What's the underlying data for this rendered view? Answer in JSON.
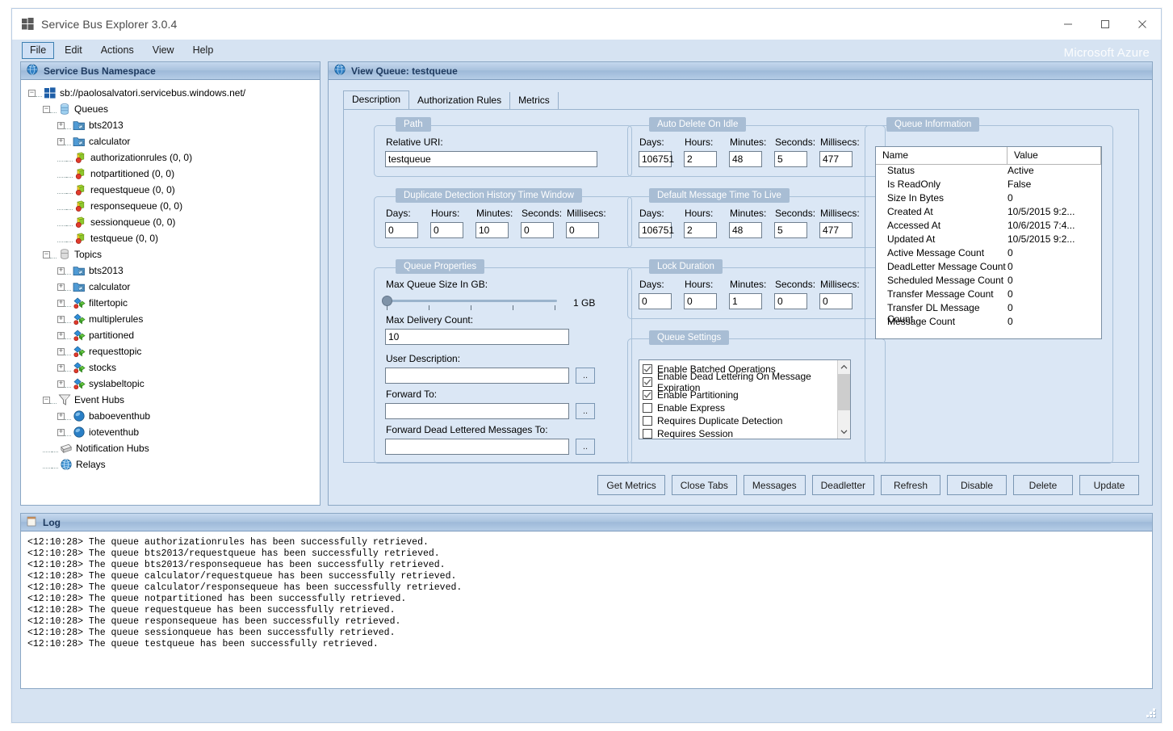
{
  "window": {
    "title": "Service Bus Explorer 3.0.4",
    "brand": "Microsoft Azure",
    "minimize": "minimize-icon",
    "maximize": "maximize-icon",
    "close": "close-icon"
  },
  "menu": {
    "items": [
      {
        "label": "File",
        "active": true
      },
      {
        "label": "Edit",
        "active": false
      },
      {
        "label": "Actions",
        "active": false
      },
      {
        "label": "View",
        "active": false
      },
      {
        "label": "Help",
        "active": false
      }
    ]
  },
  "left_panel": {
    "header": "Service Bus Namespace",
    "tree": [
      {
        "label": "sb://paolosalvatori.servicebus.windows.net/",
        "indent": 0,
        "expander": "minus",
        "icon": "namespace-icon"
      },
      {
        "label": "Queues",
        "indent": 1,
        "expander": "minus",
        "icon": "queues-icon"
      },
      {
        "label": "bts2013",
        "indent": 2,
        "expander": "plus",
        "icon": "folder-icon"
      },
      {
        "label": "calculator",
        "indent": 2,
        "expander": "plus",
        "icon": "folder-icon"
      },
      {
        "label": "authorizationrules (0, 0)",
        "indent": 2,
        "expander": "none",
        "icon": "queue-icon"
      },
      {
        "label": "notpartitioned (0, 0)",
        "indent": 2,
        "expander": "none",
        "icon": "queue-icon"
      },
      {
        "label": "requestqueue (0, 0)",
        "indent": 2,
        "expander": "none",
        "icon": "queue-icon"
      },
      {
        "label": "responsequeue (0, 0)",
        "indent": 2,
        "expander": "none",
        "icon": "queue-icon"
      },
      {
        "label": "sessionqueue (0, 0)",
        "indent": 2,
        "expander": "none",
        "icon": "queue-icon"
      },
      {
        "label": "testqueue (0, 0)",
        "indent": 2,
        "expander": "none",
        "icon": "queue-icon"
      },
      {
        "label": "Topics",
        "indent": 1,
        "expander": "minus",
        "icon": "topics-icon"
      },
      {
        "label": "bts2013",
        "indent": 2,
        "expander": "plus",
        "icon": "folder-icon"
      },
      {
        "label": "calculator",
        "indent": 2,
        "expander": "plus",
        "icon": "folder-icon"
      },
      {
        "label": "filtertopic",
        "indent": 2,
        "expander": "plus",
        "icon": "topic-icon"
      },
      {
        "label": "multiplerules",
        "indent": 2,
        "expander": "plus",
        "icon": "topic-icon"
      },
      {
        "label": "partitioned",
        "indent": 2,
        "expander": "plus",
        "icon": "topic-icon"
      },
      {
        "label": "requesttopic",
        "indent": 2,
        "expander": "plus",
        "icon": "topic-icon"
      },
      {
        "label": "stocks",
        "indent": 2,
        "expander": "plus",
        "icon": "topic-icon"
      },
      {
        "label": "syslabeltopic",
        "indent": 2,
        "expander": "plus",
        "icon": "topic-icon"
      },
      {
        "label": "Event Hubs",
        "indent": 1,
        "expander": "minus",
        "icon": "eventhubs-icon"
      },
      {
        "label": "baboeventhub",
        "indent": 2,
        "expander": "plus",
        "icon": "eventhub-icon"
      },
      {
        "label": "ioteventhub",
        "indent": 2,
        "expander": "plus",
        "icon": "eventhub-icon"
      },
      {
        "label": "Notification Hubs",
        "indent": 1,
        "expander": "none",
        "icon": "notificationhubs-icon"
      },
      {
        "label": "Relays",
        "indent": 1,
        "expander": "none",
        "icon": "relays-icon"
      }
    ]
  },
  "right_panel": {
    "header": "View Queue: testqueue",
    "tabs": [
      {
        "label": "Description",
        "selected": true
      },
      {
        "label": "Authorization Rules",
        "selected": false
      },
      {
        "label": "Metrics",
        "selected": false
      }
    ],
    "path": {
      "title": "Path",
      "relative_uri_label": "Relative URI:",
      "relative_uri_value": "testqueue"
    },
    "duplicate_detection": {
      "title": "Duplicate Detection History Time Window",
      "labels": [
        "Days:",
        "Hours:",
        "Minutes:",
        "Seconds:",
        "Millisecs:"
      ],
      "values": [
        "0",
        "0",
        "10",
        "0",
        "0"
      ]
    },
    "queue_properties": {
      "title": "Queue Properties",
      "max_queue_size_label": "Max Queue Size In GB:",
      "max_queue_size_value": "1 GB",
      "max_delivery_count_label": "Max Delivery Count:",
      "max_delivery_count_value": "10",
      "user_description_label": "User Description:",
      "user_description_value": "",
      "forward_to_label": "Forward To:",
      "forward_to_value": "",
      "forward_dl_label": "Forward Dead Lettered Messages To:",
      "forward_dl_value": "",
      "browse_label": ".."
    },
    "auto_delete": {
      "title": "Auto Delete On Idle",
      "labels": [
        "Days:",
        "Hours:",
        "Minutes:",
        "Seconds:",
        "Millisecs:"
      ],
      "values": [
        "106751",
        "2",
        "48",
        "5",
        "477"
      ]
    },
    "default_ttl": {
      "title": "Default Message Time To Live",
      "labels": [
        "Days:",
        "Hours:",
        "Minutes:",
        "Seconds:",
        "Millisecs:"
      ],
      "values": [
        "106751",
        "2",
        "48",
        "5",
        "477"
      ]
    },
    "lock_duration": {
      "title": "Lock Duration",
      "labels": [
        "Days:",
        "Hours:",
        "Minutes:",
        "Seconds:",
        "Millisecs:"
      ],
      "values": [
        "0",
        "0",
        "1",
        "0",
        "0"
      ]
    },
    "queue_settings": {
      "title": "Queue Settings",
      "options": [
        {
          "label": "Enable Batched Operations",
          "checked": true
        },
        {
          "label": "Enable Dead Lettering On Message Expiration",
          "checked": true
        },
        {
          "label": "Enable Partitioning",
          "checked": true
        },
        {
          "label": "Enable Express",
          "checked": false
        },
        {
          "label": "Requires Duplicate Detection",
          "checked": false
        },
        {
          "label": "Requires Session",
          "checked": false
        }
      ]
    },
    "queue_information": {
      "title": "Queue Information",
      "columns": [
        "Name",
        "Value"
      ],
      "rows": [
        [
          "Status",
          "Active"
        ],
        [
          "Is ReadOnly",
          "False"
        ],
        [
          "Size In Bytes",
          "0"
        ],
        [
          "Created At",
          "10/5/2015 9:2..."
        ],
        [
          "Accessed At",
          "10/6/2015 7:4..."
        ],
        [
          "Updated At",
          "10/5/2015 9:2..."
        ],
        [
          "Active Message Count",
          "0"
        ],
        [
          "DeadLetter Message Count",
          "0"
        ],
        [
          "Scheduled Message Count",
          "0"
        ],
        [
          "Transfer Message Count",
          "0"
        ],
        [
          "Transfer DL Message Count",
          "0"
        ],
        [
          "Message Count",
          "0"
        ]
      ]
    },
    "actions": [
      {
        "label": "Get Metrics"
      },
      {
        "label": "Close Tabs"
      },
      {
        "label": "Messages"
      },
      {
        "label": "Deadletter"
      },
      {
        "label": "Refresh"
      },
      {
        "label": "Disable"
      },
      {
        "label": "Delete"
      },
      {
        "label": "Update"
      }
    ]
  },
  "log_panel": {
    "header": "Log",
    "lines": [
      "<12:10:28> The queue authorizationrules has been successfully retrieved.",
      "<12:10:28> The queue bts2013/requestqueue has been successfully retrieved.",
      "<12:10:28> The queue bts2013/responsequeue has been successfully retrieved.",
      "<12:10:28> The queue calculator/requestqueue has been successfully retrieved.",
      "<12:10:28> The queue calculator/responsequeue has been successfully retrieved.",
      "<12:10:28> The queue notpartitioned has been successfully retrieved.",
      "<12:10:28> The queue requestqueue has been successfully retrieved.",
      "<12:10:28> The queue responsequeue has been successfully retrieved.",
      "<12:10:28> The queue sessionqueue has been successfully retrieved.",
      "<12:10:28> The queue testqueue has been successfully retrieved."
    ]
  },
  "colors": {
    "window_bg": "#d6e3f2",
    "panel_header_accent": "#1e3a5f",
    "group_title_bg": "#a8bdd4",
    "tab_page_bg": "#dbe7f5"
  }
}
